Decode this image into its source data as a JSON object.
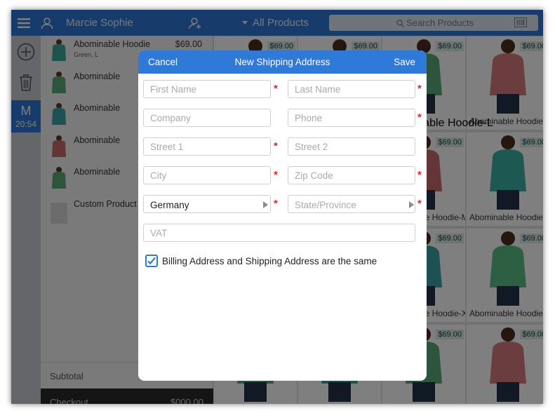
{
  "topbar": {
    "customer_name": "Marcie Sophie",
    "category": "All Products",
    "search_placeholder": "Search Products"
  },
  "rail": {
    "clerk_initial": "M",
    "clock": "20:54"
  },
  "cart": {
    "items": [
      {
        "name": "Abominable Hoodie",
        "options": "Green, L",
        "price": "$69.00",
        "color": "#3aa89a"
      },
      {
        "name": "Abominable",
        "color": "#5aa878"
      },
      {
        "name": "Abominable",
        "color": "#3aa2a8"
      },
      {
        "name": "Abominable",
        "color": "#c96a6f"
      },
      {
        "name": "Abominable",
        "color": "#5aa878"
      },
      {
        "name": "Custom Product",
        "color": "#d9d9d9"
      }
    ],
    "subtotal_label": "Subtotal",
    "checkout_label": "Checkout",
    "checkout_total": "$000.00"
  },
  "grid": {
    "cards": [
      {
        "price": "$69.00",
        "name": "",
        "color": "#c96a6f"
      },
      {
        "price": "$69.00",
        "name": "",
        "color": "#3aa2a8"
      },
      {
        "price": "$69.00",
        "name": "",
        "color": "#5aa878"
      },
      {
        "price": "$69.00",
        "name": "Abominable Hoodie",
        "color": "#d77a7e"
      },
      {
        "price": "$69.00",
        "name": "",
        "color": "#c96a6f"
      },
      {
        "price": "$69.00",
        "name": "",
        "color": "#3aa2a8"
      },
      {
        "price": "$69.00",
        "name": "Abominable Hoodie-M",
        "color": "#c96a6f"
      },
      {
        "price": "$69.00",
        "name": "Abominable Hoodie",
        "color": "#3ab0a6"
      },
      {
        "price": "$69.00",
        "name": "",
        "color": "#3aa2a8"
      },
      {
        "price": "$69.00",
        "name": "",
        "color": "#5aa878"
      },
      {
        "price": "$69.00",
        "name": "Abominable Hoodie-X",
        "color": "#3aa2a8"
      },
      {
        "price": "$69.00",
        "name": "Abominable Hoodie",
        "color": "#5abf86"
      },
      {
        "price": "$69.00",
        "name": "",
        "color": "#5aa878"
      },
      {
        "price": "$69.00",
        "name": "",
        "color": "#3aa2a8"
      },
      {
        "price": "$69.00",
        "name": "",
        "color": "#5aa878"
      },
      {
        "price": "$69.00",
        "name": "",
        "color": "#d77a7e"
      }
    ],
    "last_col_labels": [
      "Abominable Hoodie-L"
    ]
  },
  "modal": {
    "cancel": "Cancel",
    "title": "New Shipping Address",
    "save": "Save",
    "first_name_ph": "First Name",
    "last_name_ph": "Last Name",
    "company_ph": "Company",
    "phone_ph": "Phone",
    "street1_ph": "Street 1",
    "street2_ph": "Street 2",
    "city_ph": "City",
    "zip_ph": "Zip Code",
    "country_value": "Germany",
    "state_ph": "State/Province",
    "vat_ph": "VAT",
    "same_address_label": "Billing Address and Shipping Address are the same",
    "same_address_checked": true,
    "required_marker": "*"
  },
  "colors": {
    "accent": "#2f79d8",
    "required": "#e0242c"
  }
}
